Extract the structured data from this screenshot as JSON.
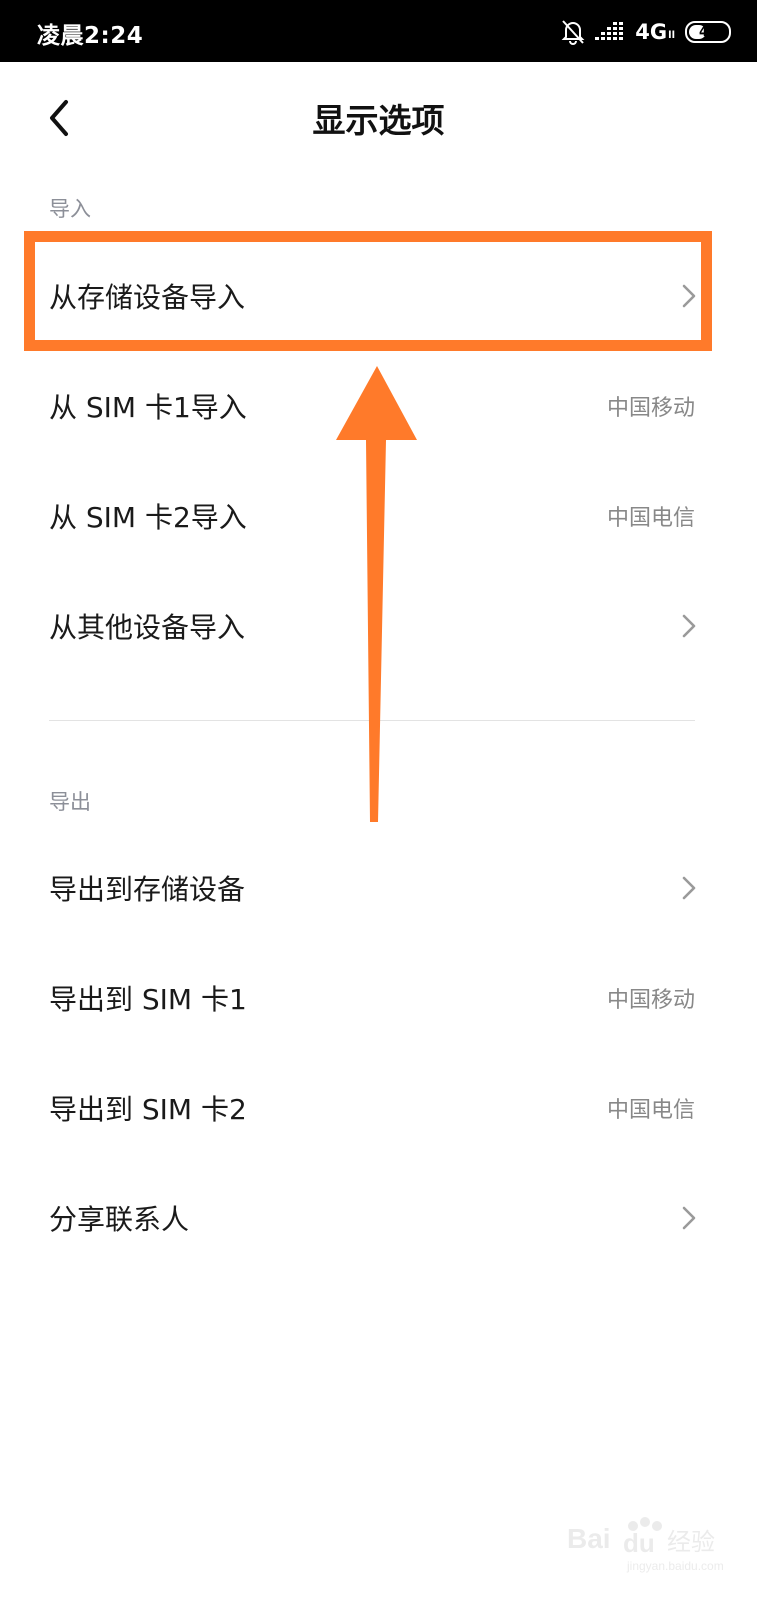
{
  "status_bar": {
    "time": "凌晨2:24",
    "network": "4G",
    "network_sub": "ll",
    "battery": "46",
    "battery_level_percent": 46,
    "icons": [
      "mute-bell-icon",
      "signal-icon"
    ]
  },
  "header": {
    "title": "显示选项",
    "back_icon": "chevron-left-icon"
  },
  "import_section": {
    "label": "导入",
    "items": [
      {
        "label": "从存储设备导入",
        "value": "",
        "icon": "chevron-right-icon"
      },
      {
        "label": "从 SIM 卡1导入",
        "value": "中国移动"
      },
      {
        "label": "从 SIM 卡2导入",
        "value": "中国电信"
      },
      {
        "label": "从其他设备导入",
        "value": "",
        "icon": "chevron-right-icon"
      }
    ]
  },
  "export_section": {
    "label": "导出",
    "items": [
      {
        "label": "导出到存储设备",
        "value": "",
        "icon": "chevron-right-icon"
      },
      {
        "label": "导出到 SIM 卡1",
        "value": "中国移动"
      },
      {
        "label": "导出到 SIM 卡2",
        "value": "中国电信"
      },
      {
        "label": "分享联系人",
        "value": "",
        "icon": "chevron-right-icon"
      }
    ]
  },
  "annotation": {
    "color": "#ff7a2a",
    "highlighted_item": "从存储设备导入"
  },
  "watermark": {
    "brand": "Bai du 经验",
    "domain": "jingyan.baidu.com"
  },
  "colors": {
    "status_bar_bg": "#000000",
    "section_label": "#8c8f98",
    "value_text": "#888888"
  }
}
